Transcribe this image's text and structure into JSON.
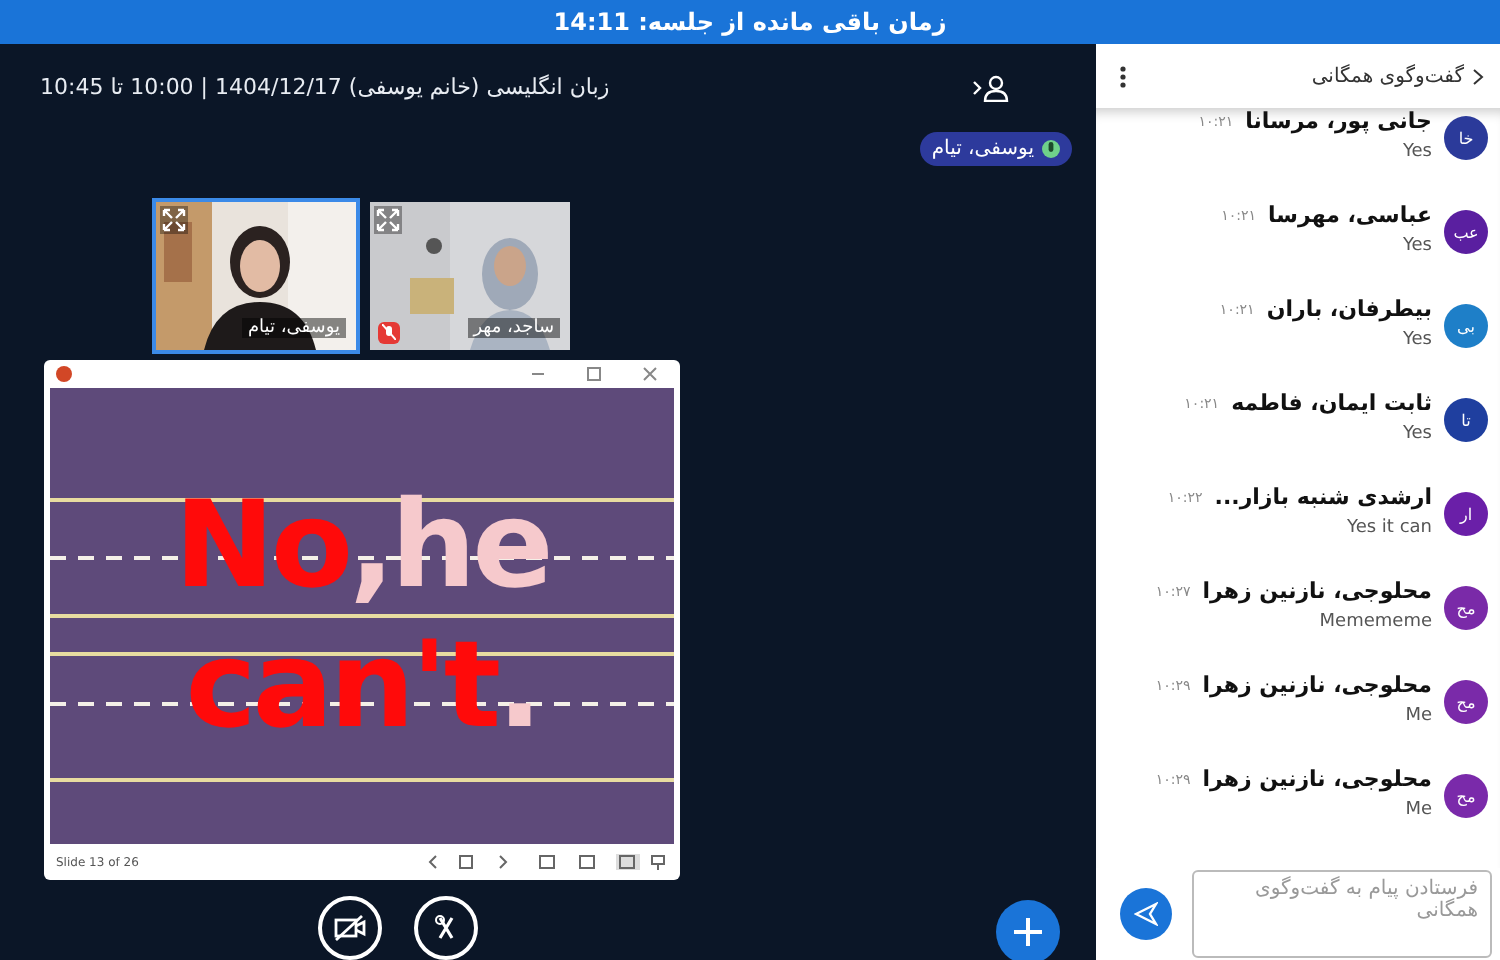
{
  "session_bar": {
    "text": "زمان باقی مانده از جلسه: 14:11"
  },
  "header": {
    "title": "زبان انگلیسی (خانم یوسفی) 1404/12/17 | 10:00 تا 10:45"
  },
  "speaker_chip": {
    "name": "یوسفی، تیام"
  },
  "videos": [
    {
      "name": "ساجد، مهر",
      "selected": false,
      "muted": true
    },
    {
      "name": "یوسفی، تیام",
      "selected": true,
      "muted": false
    }
  ],
  "slide_window": {
    "footer": "Slide 13 of 26",
    "lines": [
      {
        "start": {
          "text": "No",
          "color": "#ff0a0a"
        },
        "end": {
          "text": ",he",
          "color": "#f6c9cc"
        }
      },
      {
        "start": {
          "text": "can't",
          "color": "#ff0a0a"
        },
        "end": {
          "text": ".",
          "color": "#f6c9cc"
        }
      }
    ]
  },
  "chat": {
    "title": "گفت‌وگوی همگانی",
    "placeholder": "فرستادن پیام به گفت‌وگوی همگانی",
    "messages": [
      {
        "initials": "خا",
        "color": "#2b3a9a",
        "name": "جانی پور، مرسانا",
        "time": "۱۰:۲۱",
        "text": "Yes"
      },
      {
        "initials": "عب",
        "color": "#5a1fa0",
        "name": "عباسی، مهرسا",
        "time": "۱۰:۲۱",
        "text": "Yes"
      },
      {
        "initials": "بی",
        "color": "#1e7fc8",
        "name": "بیطرفان، باران",
        "time": "۱۰:۲۱",
        "text": "Yes"
      },
      {
        "initials": "تا",
        "color": "#1f3f9f",
        "name": "ثابت ایمان، فاطمه",
        "time": "۱۰:۲۱",
        "text": "Yes"
      },
      {
        "initials": "ار",
        "color": "#6a1fa8",
        "name": "ارشدی شنبه بازار...",
        "time": "۱۰:۲۲",
        "text": "Yes it can"
      },
      {
        "initials": "مح",
        "color": "#7a2aa8",
        "name": "محلوجی، نازنین زهرا",
        "time": "۱۰:۲۷",
        "text": "Memememe"
      },
      {
        "initials": "مح",
        "color": "#7a2aa9",
        "name": "محلوجی، نازنین زهرا",
        "time": "۱۰:۲۹",
        "text": "Me"
      },
      {
        "initials": "مح",
        "color": "#7a2aaa",
        "name": "محلوجی، نازنین زهرا",
        "time": "۱۰:۲۹",
        "text": "Me"
      }
    ]
  }
}
